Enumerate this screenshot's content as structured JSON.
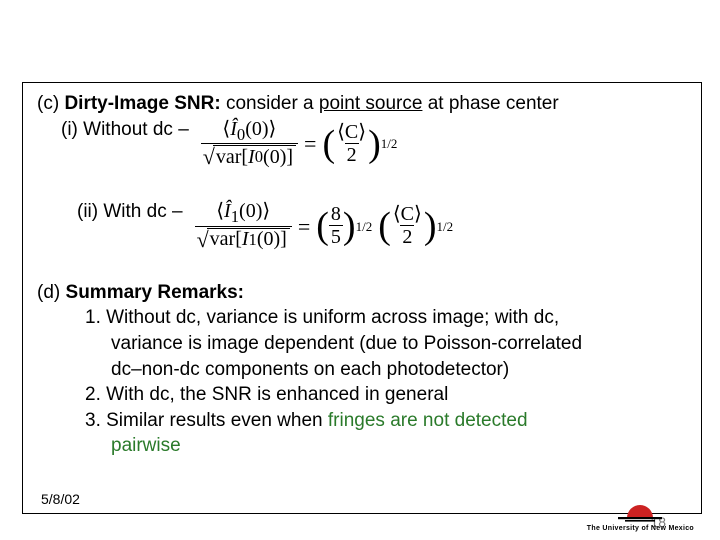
{
  "sectionC": {
    "label": "(c)",
    "heading": "Dirty-Image SNR:",
    "tail1": " consider a ",
    "underlined": "point source",
    "tail2": " at phase center",
    "i": {
      "label": "(i) Without dc –"
    },
    "ii": {
      "label": "(ii) With dc –"
    }
  },
  "eq1": {
    "numA": "⟨",
    "numHat": "Î",
    "numSub": "0",
    "numArg": "(0)⟩",
    "denPrefix": "var[",
    "denI": "I",
    "denSub": "0",
    "denArg": "(0)]",
    "equals": "=",
    "rhsNum": "⟨C⟩",
    "rhsDen": "2",
    "rhsExp": "1/2"
  },
  "eq2": {
    "numA": "⟨",
    "numHat": "Î",
    "numSub": "1",
    "numArg": "(0)⟩",
    "denPrefix": "var[",
    "denI": "I",
    "denSub": "1",
    "denArg": "(0)]",
    "equals": "=",
    "aNum": "8",
    "aDen": "5",
    "aExp": "1/2",
    "bNum": "⟨C⟩",
    "bDen": "2",
    "bExp": "1/2"
  },
  "sectionD": {
    "label": "(d)",
    "heading": "Summary Remarks:",
    "item1a": "1.  Without dc, variance is uniform across image; with dc,",
    "item1b": "variance is image dependent (due to Poisson-correlated",
    "item1c": "dc–non-dc components on each photodetector)",
    "item2": "2.  With dc, the SNR is enhanced in general",
    "item3a": "3.  Similar results even when ",
    "item3green": "fringes are not detected",
    "item3b": "pairwise"
  },
  "footer": {
    "date": "5/8/02",
    "page": "18",
    "logotext": "The University of New Mexico"
  }
}
